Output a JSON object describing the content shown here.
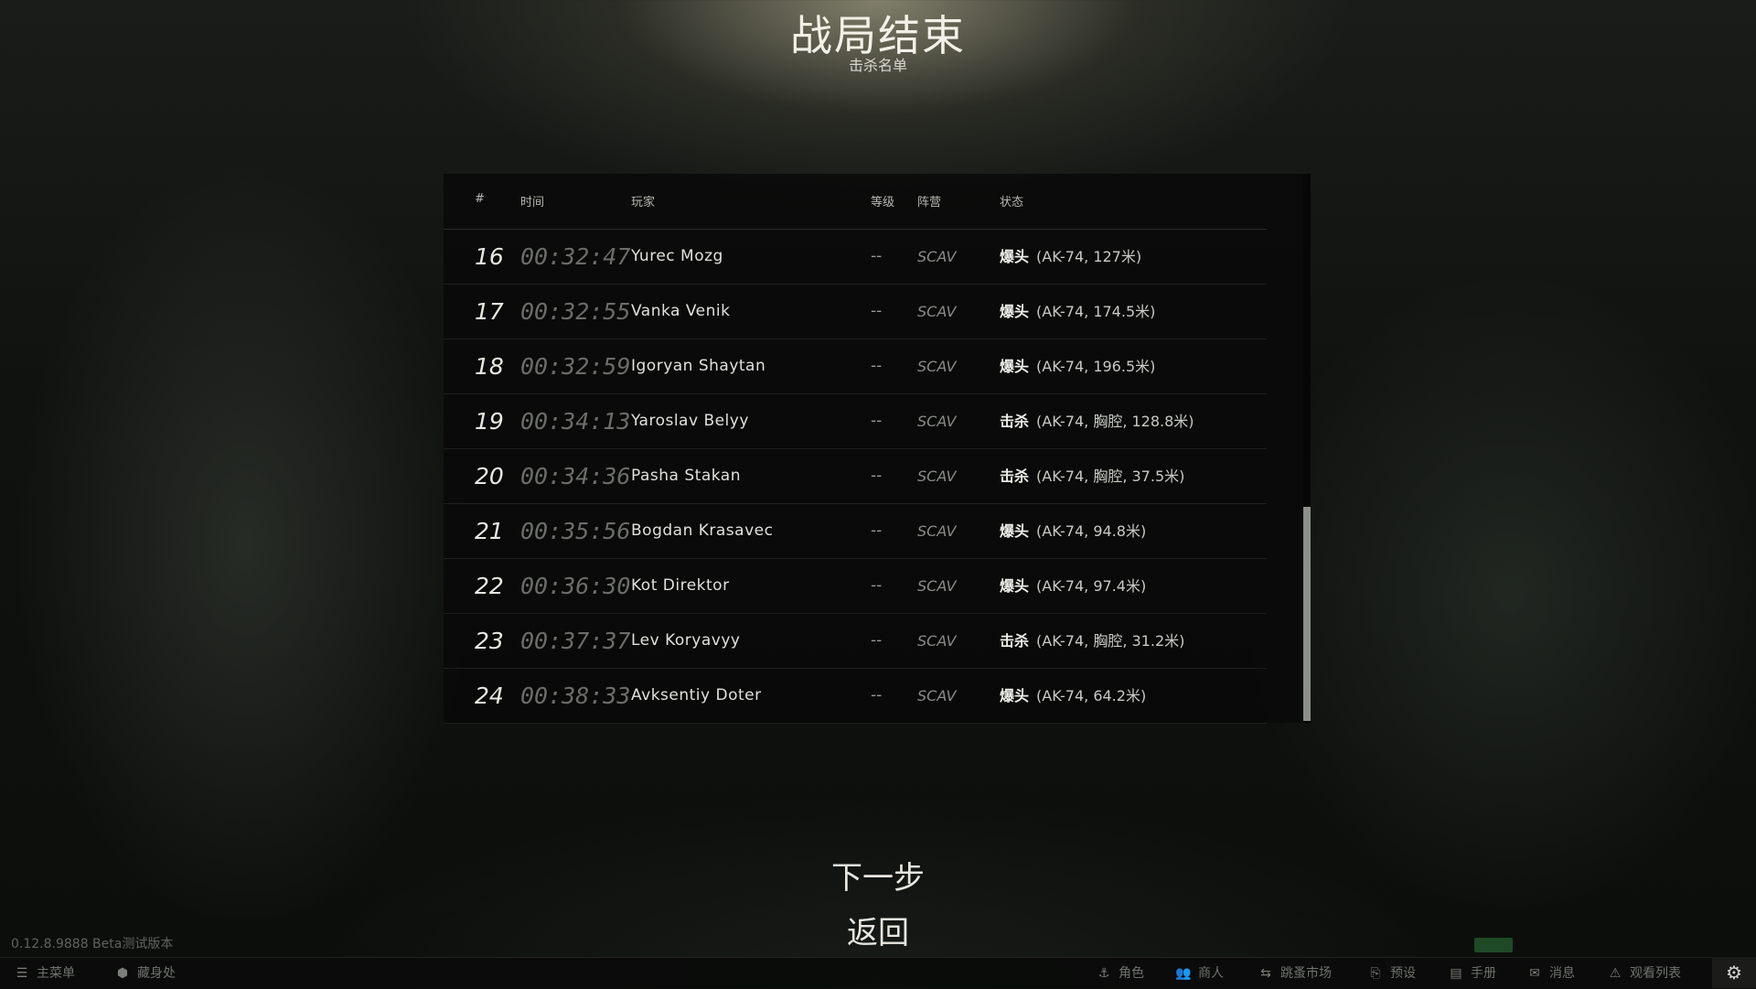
{
  "header": {
    "title": "战局结束",
    "subtitle": "击杀名单"
  },
  "table": {
    "columns": {
      "num": "#",
      "time": "时间",
      "player": "玩家",
      "level": "等级",
      "faction": "阵营",
      "status": "状态"
    },
    "rows": [
      {
        "num": "16",
        "time": "00:32:47",
        "player": "Yurec Mozg",
        "level": "--",
        "faction": "SCAV",
        "status_type": "爆头",
        "status_detail": "(AK-74, 127米)"
      },
      {
        "num": "17",
        "time": "00:32:55",
        "player": "Vanka Venik",
        "level": "--",
        "faction": "SCAV",
        "status_type": "爆头",
        "status_detail": "(AK-74, 174.5米)"
      },
      {
        "num": "18",
        "time": "00:32:59",
        "player": "Igoryan Shaytan",
        "level": "--",
        "faction": "SCAV",
        "status_type": "爆头",
        "status_detail": "(AK-74, 196.5米)"
      },
      {
        "num": "19",
        "time": "00:34:13",
        "player": "Yaroslav Belyy",
        "level": "--",
        "faction": "SCAV",
        "status_type": "击杀",
        "status_detail": "(AK-74, 胸腔, 128.8米)"
      },
      {
        "num": "20",
        "time": "00:34:36",
        "player": "Pasha Stakan",
        "level": "--",
        "faction": "SCAV",
        "status_type": "击杀",
        "status_detail": "(AK-74, 胸腔, 37.5米)"
      },
      {
        "num": "21",
        "time": "00:35:56",
        "player": "Bogdan Krasavec",
        "level": "--",
        "faction": "SCAV",
        "status_type": "爆头",
        "status_detail": "(AK-74, 94.8米)"
      },
      {
        "num": "22",
        "time": "00:36:30",
        "player": "Kot Direktor",
        "level": "--",
        "faction": "SCAV",
        "status_type": "爆头",
        "status_detail": "(AK-74, 97.4米)"
      },
      {
        "num": "23",
        "time": "00:37:37",
        "player": "Lev Koryavyy",
        "level": "--",
        "faction": "SCAV",
        "status_type": "击杀",
        "status_detail": "(AK-74, 胸腔, 31.2米)"
      },
      {
        "num": "24",
        "time": "00:38:33",
        "player": "Avksentiy Doter",
        "level": "--",
        "faction": "SCAV",
        "status_type": "爆头",
        "status_detail": "(AK-74, 64.2米)"
      }
    ]
  },
  "actions": {
    "next": "下一步",
    "back": "返回"
  },
  "version": "0.12.8.9888 Beta测试版本",
  "taskbar": {
    "left": [
      {
        "icon": "menu-icon",
        "label": "主菜单"
      },
      {
        "icon": "hideout-icon",
        "label": "藏身处"
      }
    ],
    "right": [
      {
        "icon": "character-icon",
        "label": "角色"
      },
      {
        "icon": "traders-icon",
        "label": "商人"
      },
      {
        "icon": "flea-market-icon",
        "label": "跳蚤市场"
      },
      {
        "icon": "presets-icon",
        "label": "预设"
      },
      {
        "icon": "handbook-icon",
        "label": "手册"
      },
      {
        "icon": "messenger-icon",
        "label": "消息"
      },
      {
        "icon": "watchlist-icon",
        "label": "观看列表"
      }
    ],
    "settings_icon": "settings-icon"
  },
  "colors": {
    "accent_status": "#1f4a26",
    "scroll_thumb": "#8d8f8b"
  }
}
